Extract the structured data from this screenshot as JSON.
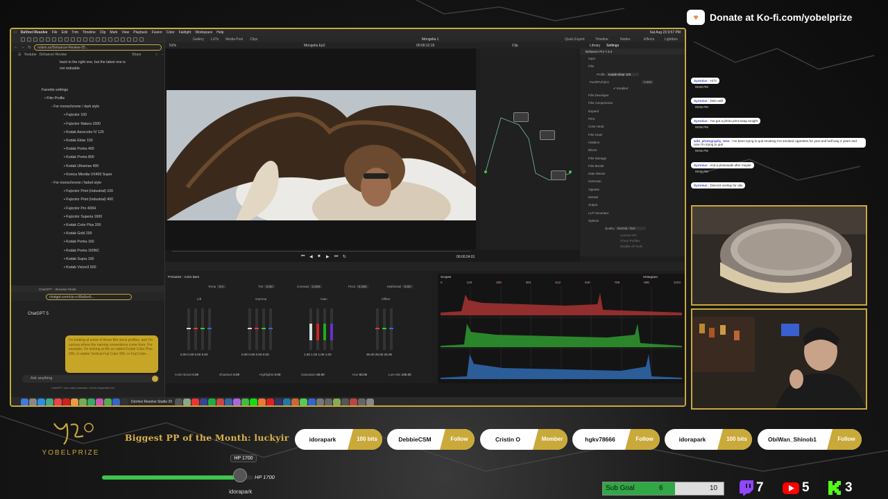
{
  "overlay": {
    "donate_text": "Donate at Ko-fi.com/yobelprize",
    "biggest_pp": "Biggest PP of the Month: luckyir",
    "logo_text": "YOBELPRIZE",
    "hp_badge": "HP 1700",
    "hp_text": "HP 1700",
    "hp_user": "idorapark",
    "hp_progress": 0.88,
    "sub_goal": {
      "label": "Sub Goal",
      "current": "6",
      "total": "10",
      "progress": 0.6
    },
    "stats": {
      "twitch": "7",
      "youtube": "5",
      "kick": "3"
    },
    "colors": {
      "gold": "#c9a93a",
      "green": "#3ec44b",
      "twitch": "#9146ff",
      "youtube": "#ff0000",
      "kick": "#53fc18"
    }
  },
  "alerts": [
    {
      "name": "idorapark",
      "tag": "100 bits"
    },
    {
      "name": "DebbieCSM",
      "tag": "Follow"
    },
    {
      "name": "Cristin O",
      "tag": "Member"
    },
    {
      "name": "hgkv78666",
      "tag": "Follow"
    },
    {
      "name": "idorapark",
      "tag": "100 bits"
    },
    {
      "name": "ObiWan_Shinob1",
      "tag": "Follow"
    }
  ],
  "chat": [
    {
      "user": "Syronius",
      "text": "Hi hi",
      "time": "09:50 PM"
    },
    {
      "user": "Syronius",
      "text": "Dein well",
      "time": "09:55 PM"
    },
    {
      "user": "Syronius",
      "text": "I've got a photo print swap tonight",
      "time": "09:56 PM"
    },
    {
      "user": "wild_photography_teen",
      "text": "I've been trying to quit smoking I've smoked cigarettes for year and half avig 4 years and now I'm trying to quit",
      "time": "09:56 PM"
    },
    {
      "user": "Syronius",
      "text": "And a photowalk after maybe",
      "time": "09:56 PM"
    },
    {
      "user": "Syronius",
      "text": "Discord overlay for obs",
      "time": "09:56 PM"
    }
  ],
  "mac": {
    "menu": [
      "DaVinci Resolve",
      "File",
      "Edit",
      "Trim",
      "Timeline",
      "Clip",
      "Mark",
      "View",
      "Playback",
      "Fusion",
      "Color",
      "Fairlight",
      "Workspace",
      "Help"
    ],
    "clock": "Sat Aug 23  9:57 PM"
  },
  "browser": {
    "url": "notion.so/Dehancer-Review-25...",
    "crumb1": "Youtube",
    "crumb2": "Dehancer Review",
    "share": "Share",
    "intro1": "back to the right one, but the latest one is",
    "intro2": "not redoable",
    "heading": "Favorite settings",
    "film_profile": "Film Profile",
    "group1": "For monochrome / dark style",
    "list1": [
      "Fujicolor 100",
      "Fujicolor Natura 1600",
      "Kodak Aerocolor IV 125",
      "Kodak Ektar 100",
      "Kodak Portra 400",
      "Kodak Portra 800",
      "Kodak Ultramax 400",
      "Konica Minolta VX400 Super"
    ],
    "group2": "For monochrome / faded style",
    "list2": [
      "Fujicolor Print (Industrial) 100",
      "Fujicolor Print (Industrial) 400",
      "Fujicolor Pro 400H",
      "Fujicolor Superia 1600",
      "Kodak Color Plus 200",
      "Kodak Gold 200",
      "Kodak Portra 160",
      "Kodak Portra 160NC",
      "Kodak Supra 100",
      "Kodak Vision3 500"
    ]
  },
  "chatgpt": {
    "tab": "ChatGPT – Browser Mode",
    "url": "chatgpt.com/c/p-o-68a9ce5...",
    "model": "ChatGPT 5",
    "bubble": "I'm looking at some of these film stock profiles, and I'm curious where the naming conventions come from. For example, I'm looking at the so-called Kodak Color Plus 200, or earlier Vertical Fuji Color 300, or Fuji Color...",
    "ask": "Ask anything",
    "disclaimer": "ChatGPT can make mistakes. Check important info."
  },
  "resolve": {
    "tabs": [
      "Gallery",
      "LUTs",
      "Media Pool",
      "Clips"
    ],
    "project": "Mongolia 1",
    "timeline": "Mongolia Ep2",
    "timecode_top": "00:00:12:16",
    "zoom": "51%",
    "clip_label": "Clip",
    "right_tabs": [
      "Quick Export",
      "Timeline",
      "Nodes",
      "Effects",
      "Lightbox"
    ],
    "timecode": "00:00:24:01",
    "settings_tabs": [
      "Library",
      "Settings"
    ],
    "plugin": "Dehancer Pro 7.3.4",
    "profile_label": "Profile",
    "profile_value": "Kodak Ektar 100",
    "push_label": "Push/Pull (Ev)",
    "push_value": "0.000",
    "enabled": "Enabled",
    "settings_items": [
      "Input",
      "Film",
      "Film Developer",
      "Film Compression",
      "Expand",
      "Print",
      "Color Head",
      "Film Grain",
      "Halation",
      "Bloom",
      "Film Damage",
      "Film Breath",
      "Gate Weave",
      "Overscan",
      "Vignette",
      "Monitor",
      "Output",
      "LUT Generator",
      "Options"
    ],
    "quality_label": "Quality",
    "quality_value": "Normal - fast",
    "options": [
      "License Info",
      "Check Profiles",
      "Disable All Tools"
    ],
    "primaries_title": "Primaries - Color Bars",
    "primaries_params": [
      {
        "label": "Temp",
        "value": "0.0"
      },
      {
        "label": "Tint",
        "value": "0.00"
      },
      {
        "label": "Contrast",
        "value": "1.000"
      },
      {
        "label": "Pivot",
        "value": "0.435"
      },
      {
        "label": "Mid/Detail",
        "value": "0.00"
      }
    ],
    "wheels": [
      {
        "name": "Lift",
        "values": [
          "0.00",
          "0.00",
          "0.00",
          "0.00"
        ]
      },
      {
        "name": "Gamma",
        "values": [
          "0.00",
          "0.00",
          "0.00",
          "0.00"
        ]
      },
      {
        "name": "Gain",
        "values": [
          "1.00",
          "1.00",
          "1.00",
          "1.00"
        ]
      },
      {
        "name": "Offset",
        "values": [
          "25.00",
          "25.00",
          "25.00"
        ]
      }
    ],
    "bottom_params": [
      {
        "label": "Color Boost",
        "value": "0.00"
      },
      {
        "label": "Shadows",
        "value": "0.00"
      },
      {
        "label": "Highlights",
        "value": "0.00"
      },
      {
        "label": "Saturation",
        "value": "50.00"
      },
      {
        "label": "Hue",
        "value": "50.00"
      },
      {
        "label": "Lum Mix",
        "value": "100.00"
      }
    ],
    "scopes_title": "Scopes",
    "scope_mode": "Histogram",
    "scope_ticks": [
      "0",
      "128",
      "256",
      "384",
      "512",
      "640",
      "768",
      "896",
      "1023"
    ],
    "dock_app": "DaVinci Resolve Studio 20"
  }
}
